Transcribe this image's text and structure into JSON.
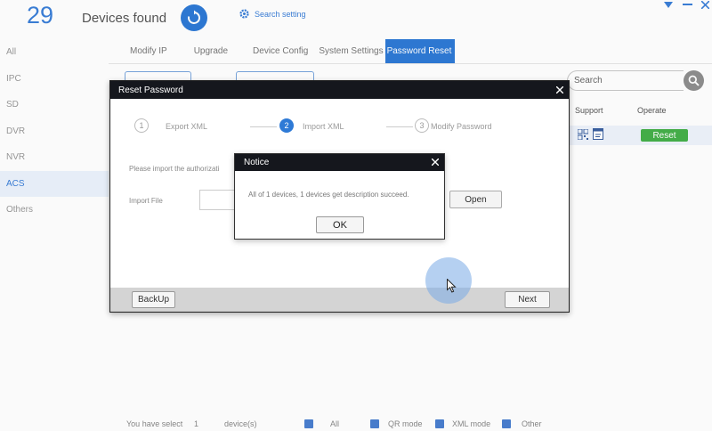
{
  "header": {
    "device_count": "29",
    "devices_found_label": "Devices found",
    "search_setting_label": "Search setting"
  },
  "sidebar": {
    "items": [
      {
        "label": "All"
      },
      {
        "label": "IPC"
      },
      {
        "label": "SD"
      },
      {
        "label": "DVR"
      },
      {
        "label": "NVR"
      },
      {
        "label": "ACS",
        "active": true
      },
      {
        "label": "Others"
      }
    ]
  },
  "toolbar": {
    "tabs": [
      {
        "label": "Modify IP"
      },
      {
        "label": "Upgrade"
      },
      {
        "label": "Device Config"
      },
      {
        "label": "System Settings"
      },
      {
        "label": "Password Reset",
        "active": true
      }
    ]
  },
  "search": {
    "placeholder": "Search"
  },
  "table": {
    "columns": [
      "Support",
      "Operate"
    ],
    "row": {
      "operate_label": "Reset"
    }
  },
  "footer": {
    "selected_prefix": "You have select",
    "selected_count": "1",
    "selected_suffix": "device(s)",
    "filters": [
      "All",
      "QR mode",
      "XML mode",
      "Other"
    ]
  },
  "reset_dialog": {
    "title": "Reset Password",
    "steps": [
      {
        "number": "1",
        "label": "Export XML",
        "active": false
      },
      {
        "number": "2",
        "label": "Import XML",
        "active": true
      },
      {
        "number": "3",
        "label": "Modify Password",
        "active": false
      }
    ],
    "instruction": "Please import the authorizati",
    "import_file_label": "Import File",
    "open_label": "Open",
    "backup_label": "BackUp",
    "next_label": "Next"
  },
  "notice": {
    "title": "Notice",
    "message": "All of 1 devices, 1 devices get description succeed.",
    "ok_label": "OK"
  },
  "colors": {
    "accent": "#2e7ad6",
    "dialog_title_bg": "#15171d",
    "reset_green": "#45b04a"
  }
}
